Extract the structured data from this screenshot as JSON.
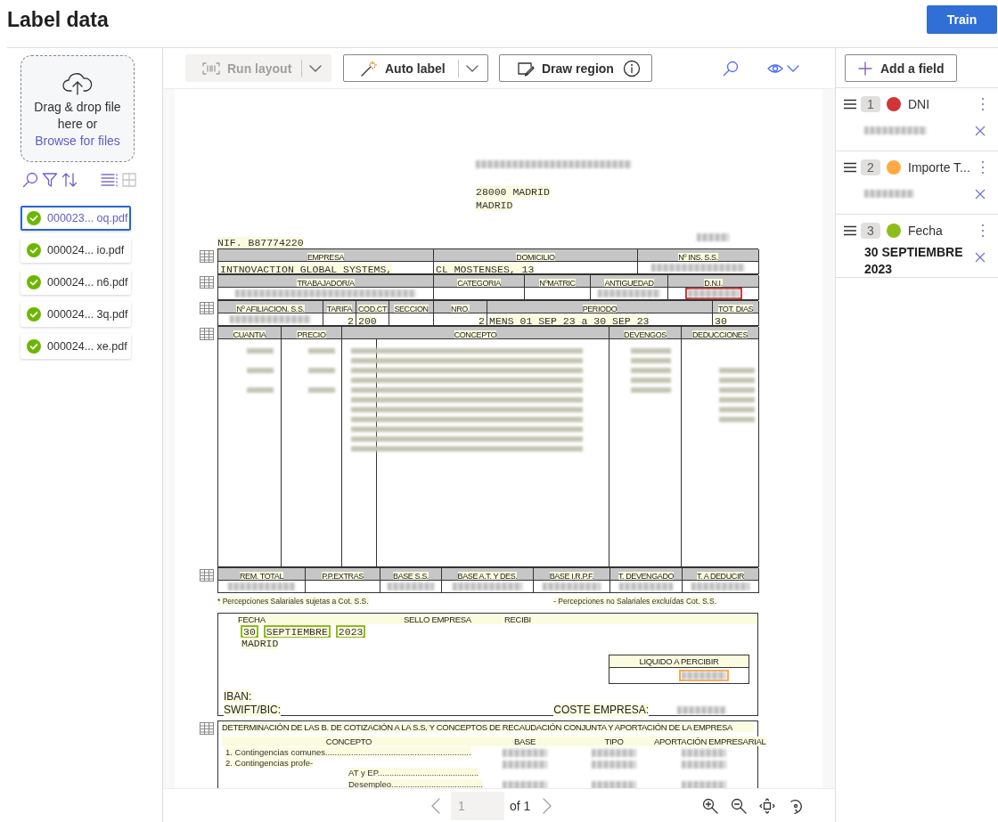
{
  "header": {
    "title": "Label data",
    "train_button": "Train"
  },
  "files_panel": {
    "dropzone": {
      "text": "Drag & drop file here or",
      "link": "Browse for files"
    },
    "views": [
      {
        "kind": "list",
        "selected": true
      },
      {
        "kind": "grid",
        "selected": false
      }
    ],
    "files": [
      {
        "name": "000023... oq.pdf",
        "selected": true
      },
      {
        "name": "000024...  io.pdf",
        "selected": false
      },
      {
        "name": "000024... n6.pdf",
        "selected": false
      },
      {
        "name": "000024... 3q.pdf",
        "selected": false
      },
      {
        "name": "000024... xe.pdf",
        "selected": false
      }
    ]
  },
  "toolbar": {
    "buttons": [
      {
        "kind": "split",
        "label": "Run layout",
        "disabled": true
      },
      {
        "kind": "split",
        "label": "Auto label",
        "disabled": false
      },
      {
        "kind": "info",
        "label": "Draw region",
        "disabled": false
      }
    ]
  },
  "document": {
    "address": [
      {
        "kind": "redacted"
      },
      {
        "kind": "text",
        "text": "28000  MADRID"
      },
      {
        "kind": "text",
        "text": "MADRID"
      }
    ],
    "nif": "NIF. B87774220",
    "tables": [
      {
        "header": [
          "EMPRESA",
          "DOMICILIO",
          "Nº INS. S.S."
        ],
        "rows": [
          [
            {
              "kind": "text",
              "text": "INTNOVACTION GLOBAL SYSTEMS,"
            },
            {
              "kind": "text",
              "text": "CL MOSTENSES, 13"
            },
            {
              "kind": "redacted"
            }
          ]
        ]
      },
      {
        "header": [
          "TRABAJADOR/A",
          "CATEGORIA",
          "NºMATRIC",
          "ANTIGUEDAD",
          "D.N.I."
        ],
        "rows": [
          [
            {
              "kind": "redacted"
            },
            {
              "kind": "empty"
            },
            {
              "kind": "empty"
            },
            {
              "kind": "redacted"
            },
            {
              "kind": "redacted",
              "color": "#d13438"
            }
          ]
        ]
      },
      {
        "header": [
          "Nº AFILIACION. S.S.",
          "TARIFA",
          "COD.CT",
          "SECCION",
          "NRO.",
          "PERIODO",
          "TOT. DIAS"
        ],
        "rows": [
          [
            {
              "kind": "redacted"
            },
            {
              "kind": "number",
              "text": "2"
            },
            {
              "kind": "text",
              "text": "200"
            },
            {
              "kind": "empty"
            },
            {
              "kind": "number",
              "text": "2"
            },
            {
              "kind": "text",
              "text": "MENS 01 SEP 23 a 30 SEP 23"
            },
            {
              "kind": "text",
              "text": "30"
            }
          ]
        ]
      },
      {
        "header": [
          "CUANTIA",
          "PRECIO",
          "CONCEPTO",
          "DEVENGOS",
          "DEDUCCIONES"
        ],
        "rows": [
          [
            {
              "kind": "block"
            },
            {
              "kind": "block"
            },
            {
              "kind": "block"
            },
            {
              "kind": "block"
            },
            {
              "kind": "block"
            }
          ]
        ]
      },
      {
        "header": [
          "REM. TOTAL",
          "P.P.EXTRAS",
          "BASE S.S.",
          "BASE A.T. Y DES.",
          "BASE I.R.P.F.",
          "T. DEVENGADO",
          "T.  A DEDUCIR"
        ],
        "rows": [
          [
            {
              "kind": "redacted"
            },
            {
              "kind": "empty"
            },
            {
              "kind": "redacted"
            },
            {
              "kind": "redacted"
            },
            {
              "kind": "redacted"
            },
            {
              "kind": "redacted"
            },
            {
              "kind": "redacted"
            }
          ]
        ]
      }
    ],
    "notes": [
      "* Percepciones Salariales  sujetas a Cot. S.S.",
      "- Percepciones no Salariales excluídas Cot. S.S."
    ],
    "sign_box": {
      "labels": [
        "FECHA",
        "SELLO EMPRESA",
        "RECIBI"
      ],
      "date_words": [
        {
          "text": "30",
          "color": "#8cbd18"
        },
        {
          "text": "SEPTIEMBRE",
          "color": "#8cbd18"
        },
        {
          "text": "2023",
          "color": "#8cbd18"
        }
      ],
      "place": "MADRID",
      "net_pay": {
        "label": "LIQUIDO A PERCIBIR",
        "color": "#ffaa44"
      },
      "iban": "IBAN:",
      "swift": "SWIFT/BIC:",
      "cost_label": "COSTE EMPRESA:"
    },
    "contributions": {
      "title": "DETERMINACIÓN DE LAS B. DE COTIZACIÓN A LA S.S. Y CONCEPTOS DE RECAUDACIÓN CONJUNTA Y APORTACIÓN DE LA EMPRESA",
      "columns": [
        "CONCEPTO",
        "BASE",
        "TIPO",
        "APORTACIÓN EMPRESARIAL"
      ],
      "rows": [
        {
          "concept": "1. Contingencias comunes.............................................................."
        },
        {
          "concept": "2. Contingencias profe-",
          "sub": "AT y EP..........................................."
        },
        {
          "sub": "Desempleo......................................."
        }
      ]
    }
  },
  "pager": {
    "page": "1",
    "total": "of 1"
  },
  "add_field_button": "Add a field",
  "fields": [
    {
      "number": "1",
      "name": "DNI",
      "color": "#d13438",
      "kind": "redacted"
    },
    {
      "number": "2",
      "name": "Importe T...",
      "color": "#ffaa44",
      "kind": "redacted"
    },
    {
      "number": "3",
      "name": "Fecha",
      "color": "#8cbd18",
      "kind": "text",
      "value": "30 SEPTIEMBRE 2023"
    }
  ]
}
